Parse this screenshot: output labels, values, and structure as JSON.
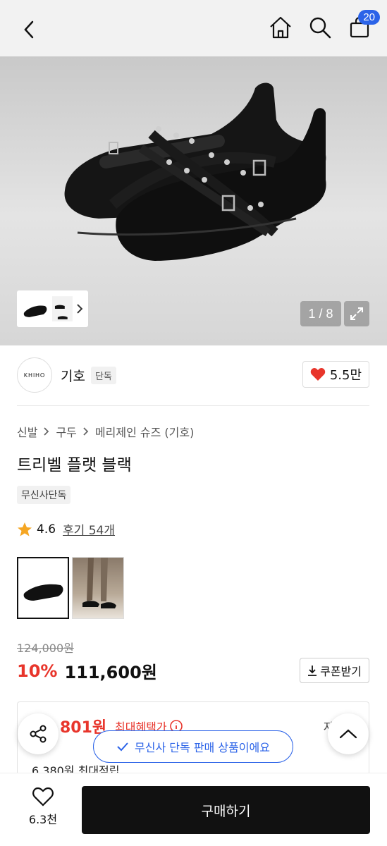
{
  "header": {
    "cart_count": "20"
  },
  "hero": {
    "page_indicator": "1 / 8"
  },
  "brand": {
    "logo_text": "KHIHO",
    "name": "기호",
    "tag": "단독",
    "likes": "5.5만"
  },
  "breadcrumb": [
    "신발",
    "구두",
    "메리제인 슈즈 (기호)"
  ],
  "product": {
    "title": "트리벨 플랫 블랙",
    "exclusive_tag": "무신사단독"
  },
  "rating": {
    "score": "4.6",
    "review_text": "후기 54개"
  },
  "price": {
    "original": "124,000원",
    "discount": "10%",
    "sale": "111,600원",
    "coupon_label": "쿠폰받기"
  },
  "benefit": {
    "amount": "801원",
    "label": "최대혜택가",
    "detail": "자세히",
    "points": "6,380원 최대적립"
  },
  "toast": {
    "text": "무신사 단독 판매 상품이에요"
  },
  "bottom": {
    "wish_count": "6.3천",
    "buy_label": "구매하기"
  },
  "colors": {
    "accent": "#2b63e8",
    "sale": "#e8352b",
    "buy_bg": "#111111"
  }
}
